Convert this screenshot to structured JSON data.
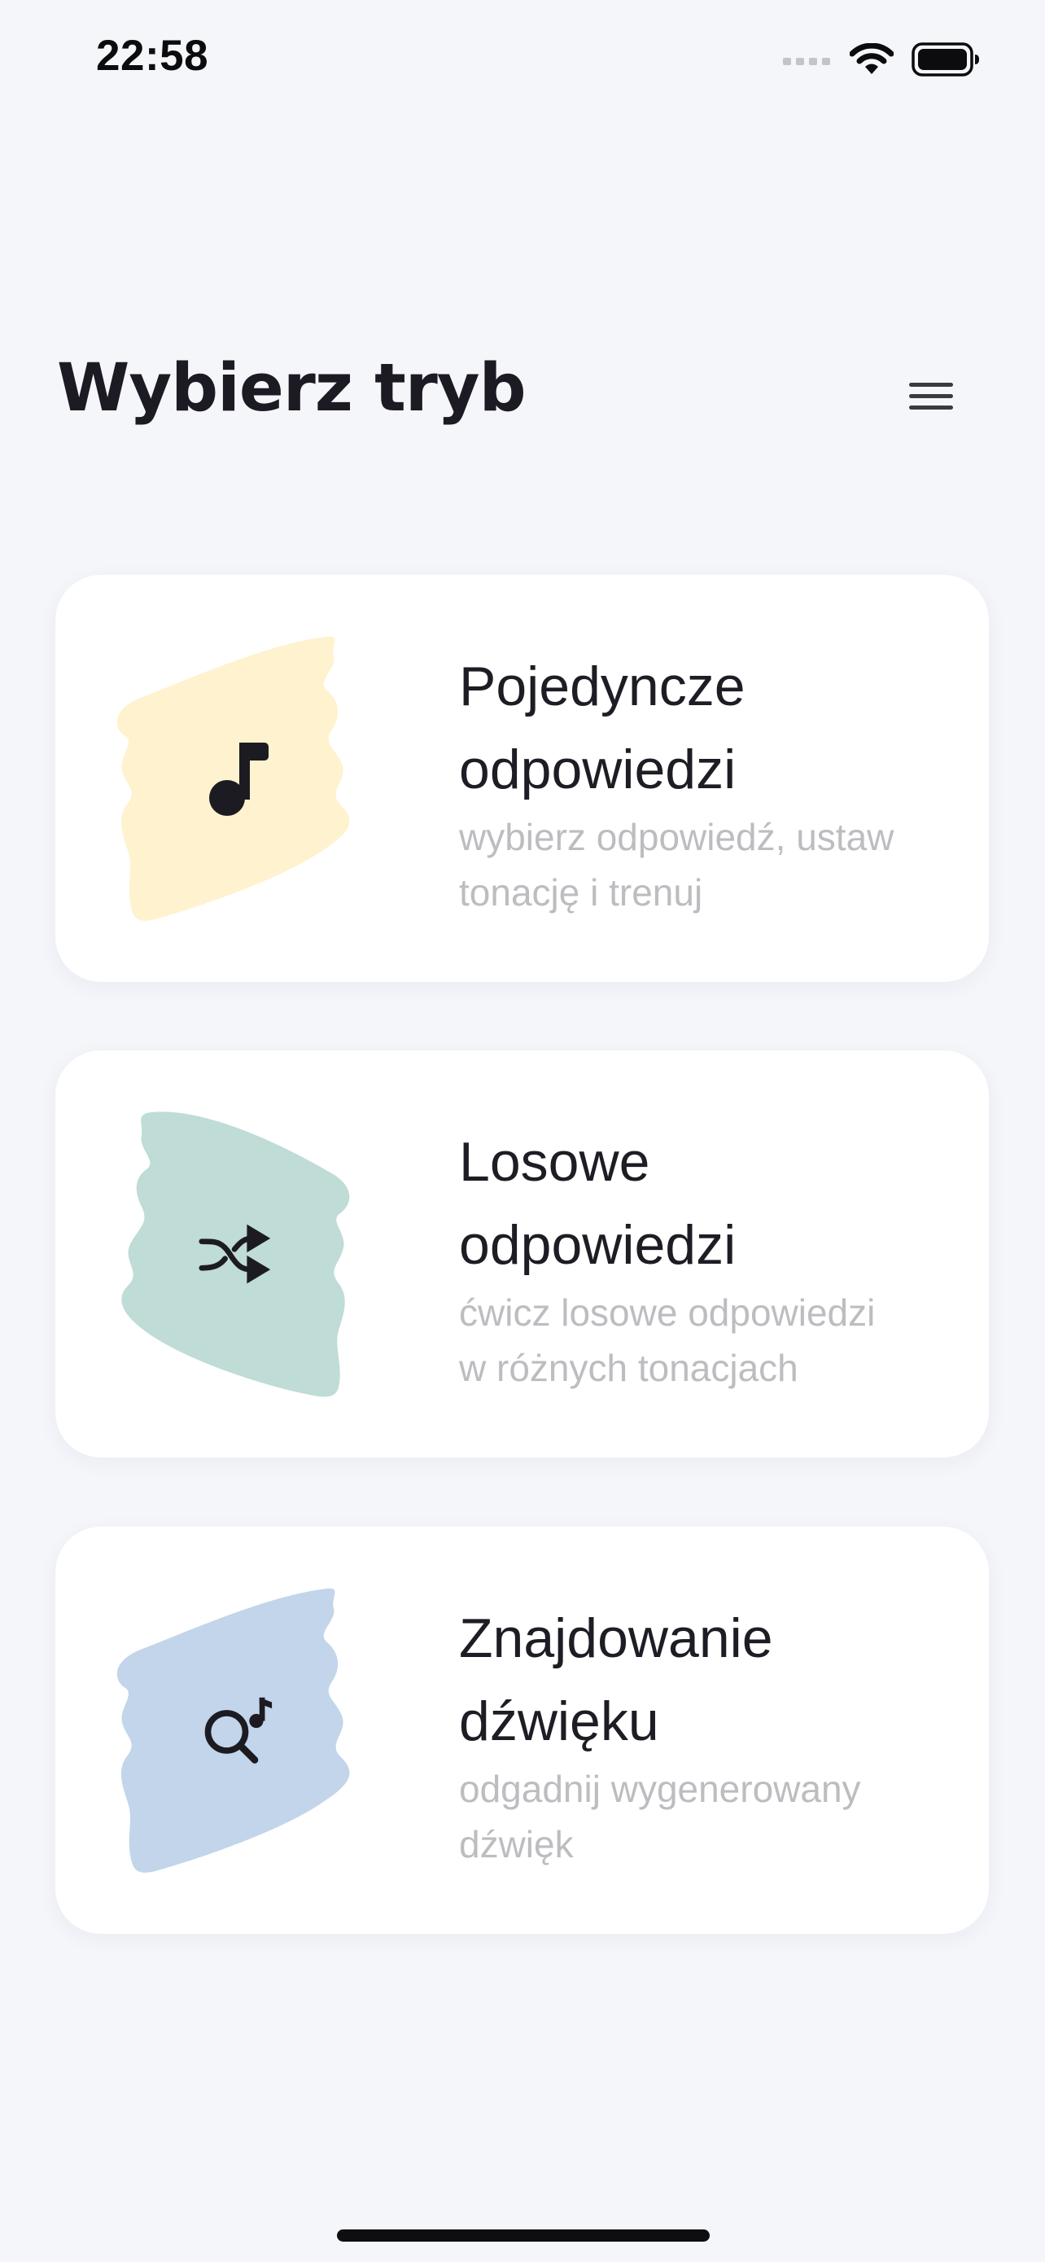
{
  "status_bar": {
    "time": "22:58"
  },
  "header": {
    "title": "Wybierz tryb"
  },
  "modes": [
    {
      "title_line1": "Pojedyncze",
      "title_line2": "odpowiedzi",
      "desc_line1": "wybierz odpowiedź, ustaw",
      "desc_line2": "tonację i trenuj",
      "icon": "music-note-icon",
      "blob_color": "#fff2cf"
    },
    {
      "title_line1": "Losowe",
      "title_line2": "odpowiedzi",
      "desc_line1": "ćwicz losowe odpowiedzi",
      "desc_line2": "w różnych tonacjach",
      "icon": "shuffle-icon",
      "blob_color": "#bfdcd7"
    },
    {
      "title_line1": "Znajdowanie",
      "title_line2": "dźwięku",
      "desc_line1": "odgadnij wygenerowany",
      "desc_line2": "dźwięk",
      "icon": "search-music-icon",
      "blob_color": "#c2d5ea"
    }
  ],
  "colors": {
    "background": "#f5f6fa",
    "card": "#ffffff",
    "title_text": "#1c1a22",
    "desc_text": "#bdbdc1",
    "icon": "#1d1b22"
  }
}
